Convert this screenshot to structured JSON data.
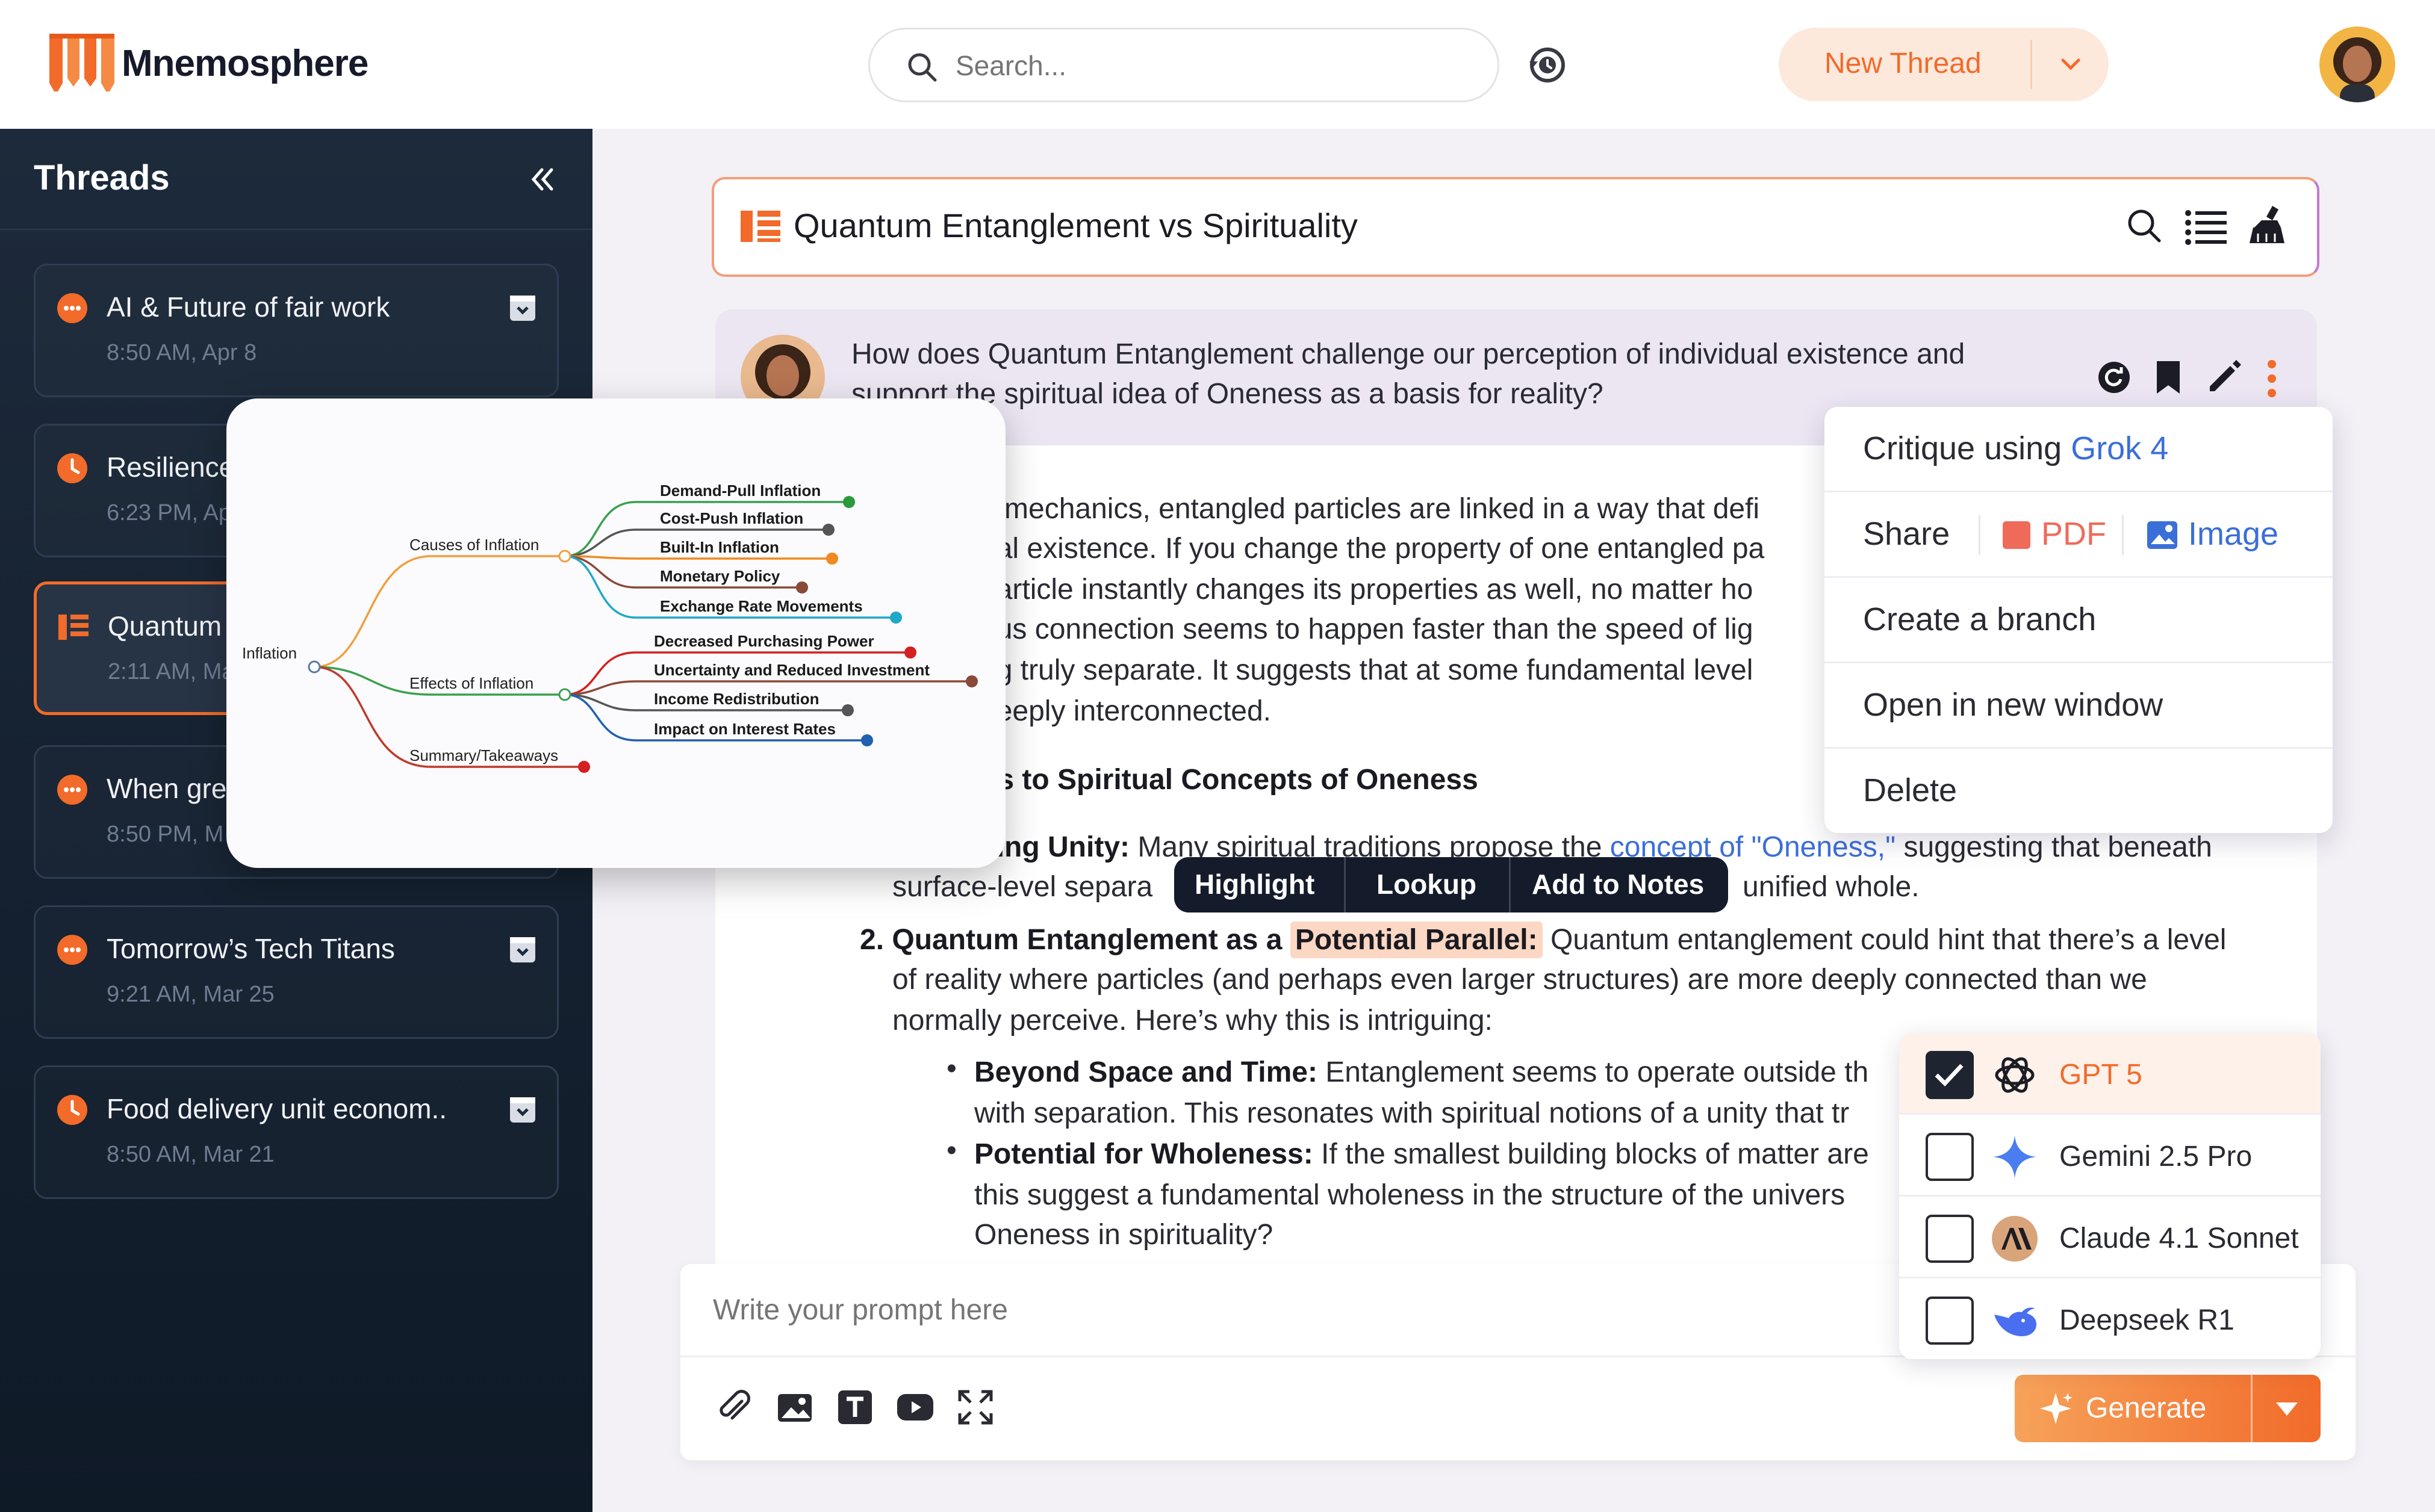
{
  "app": {
    "name": "Mnemosphere"
  },
  "search": {
    "placeholder": "Search..."
  },
  "new_thread": {
    "label": "New Thread"
  },
  "sidebar": {
    "title": "Threads",
    "threads": [
      {
        "title": "AI & Future of fair work",
        "time": "8:50 AM, Apr 8",
        "icon": "chat-bubble-icon"
      },
      {
        "title": "Resilience",
        "time": "6:23 PM, Ap",
        "icon": "clock-icon"
      },
      {
        "title": "Quantum",
        "time": "2:11 AM, Ma",
        "icon": "thread-icon",
        "active": true
      },
      {
        "title": "When gre",
        "time": "8:50 PM, M",
        "icon": "chat-bubble-icon"
      },
      {
        "title": "Tomorrow’s Tech Titans",
        "time": "9:21 AM, Mar 25",
        "icon": "chat-bubble-icon"
      },
      {
        "title": "Food delivery unit econom..",
        "time": "8:50 AM, Mar 21",
        "icon": "clock-icon"
      }
    ]
  },
  "thread": {
    "title": "Quantum Entanglement vs Spirituality"
  },
  "question": {
    "line1": "How does Quantum Entanglement challenge our perception of individual existence and",
    "line2": "support the spiritual idea of Oneness as a basis for reality?"
  },
  "answer": {
    "p1": [
      "n mechanics, entangled particles are linked in a way that defi",
      "ual existence. If you change the property of one entangled pa",
      "particle instantly changes its properties as well, no matter ho",
      "ous connection seems to happen faster than the speed of lig",
      "ng truly separate. It suggests that at some fundamental level",
      " deeply interconnected."
    ],
    "heading": "ns to Spiritual Concepts of Oneness",
    "item1": {
      "bold": "ying Unity:",
      "text_before_link": " Many spiritual traditions propose the ",
      "link": "concept of \"Oneness,\"",
      "text_after_link": " suggesting that beneath",
      "line2_a": "surface-level separa",
      "line2_b": " unified whole."
    },
    "item2": {
      "num": "2.",
      "bold": "Quantum Entanglement as a ",
      "highlight": "Potential Parallel:",
      "text": " Quantum entanglement could hint that there’s a level",
      "line2": "of reality where particles (and perhaps even larger structures) are more deeply connected than we",
      "line3": "normally perceive. Here’s why this is intriguing:"
    },
    "bullets": [
      {
        "bold": "Beyond Space and Time:",
        "line1": " Entanglement seems to operate outside th",
        "line2": "with separation. This resonates with spiritual notions of a unity that tr"
      },
      {
        "bold": "Potential for Wholeness:",
        "line1": " If the smallest building blocks of matter are",
        "line2": "this suggest a fundamental wholeness in the structure of the univers",
        "line3": "Oneness in spirituality?"
      }
    ]
  },
  "mindmap": {
    "root": "Inflation",
    "branches": [
      {
        "label": "Causes of Inflation",
        "children": [
          "Demand-Pull Inflation",
          "Cost-Push Inflation",
          "Built-In Inflation",
          "Monetary Policy",
          "Exchange Rate Movements"
        ]
      },
      {
        "label": "Effects of Inflation",
        "children": [
          "Decreased Purchasing Power",
          "Uncertainty and Reduced Investment",
          "Income Redistribution",
          "Impact on Interest Rates"
        ]
      },
      {
        "label": "Summary/Takeaways",
        "children": []
      }
    ]
  },
  "context_menu": {
    "critique_prefix": "Critique using ",
    "critique_model": "Grok 4",
    "share": "Share",
    "pdf": "PDF",
    "image": "Image",
    "branch": "Create a branch",
    "new_window": "Open in new window",
    "delete": "Delete"
  },
  "highlight_toolbar": {
    "highlight": "Highlight",
    "lookup": "Lookup",
    "notes": "Add to Notes"
  },
  "prompt": {
    "placeholder": "Write your prompt here"
  },
  "generate": {
    "label": "Generate"
  },
  "models": [
    {
      "name": "GPT 5",
      "checked": true,
      "icon": "openai-icon"
    },
    {
      "name": "Gemini 2.5 Pro",
      "checked": false,
      "icon": "gemini-icon"
    },
    {
      "name": "Claude 4.1 Sonnet",
      "checked": false,
      "icon": "anthropic-icon"
    },
    {
      "name": "Deepseek R1",
      "checked": false,
      "icon": "deepseek-icon"
    }
  ],
  "colors": {
    "accent": "#f26b2a",
    "sidebar": "#1d2a3b",
    "link": "#3b6fd8"
  }
}
